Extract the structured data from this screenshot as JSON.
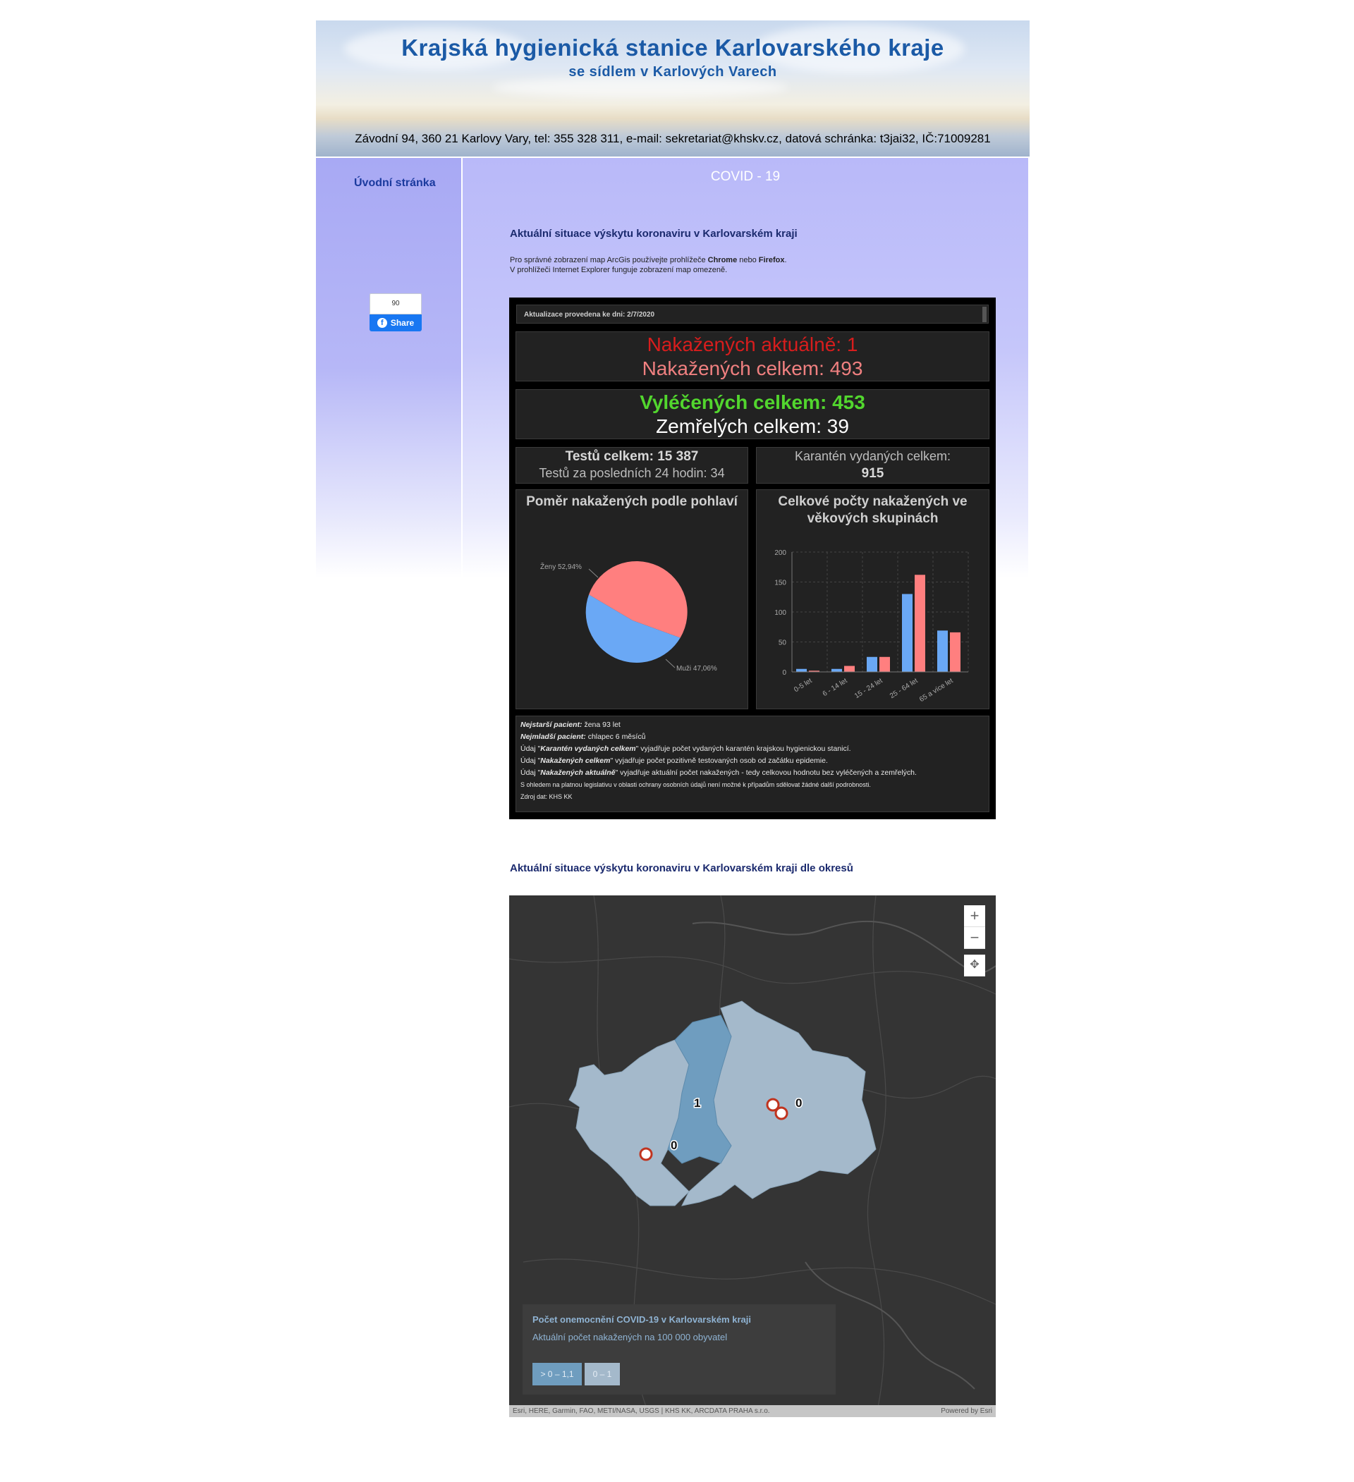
{
  "header": {
    "title": "Krajská hygienická stanice Karlovarského kraje",
    "subtitle": "se sídlem v Karlových Varech",
    "contact": "Závodní 94, 360 21 Karlovy Vary, tel: 355 328 311, e-mail: sekretariat@khskv.cz, datová schránka: t3jai32, IČ:71009281"
  },
  "sidebar": {
    "home_link": "Úvodní stránka",
    "fb_count": "90",
    "fb_share": "Share"
  },
  "main": {
    "heading": "COVID - 19",
    "section1_title": "Aktuální situace výskytu koronaviru v Karlovarském kraji",
    "note_line1_pre": "Pro správné zobrazení map ArcGis používejte prohlížeče ",
    "note_chrome": "Chrome",
    "note_mid": " nebo ",
    "note_firefox": "Firefox",
    "note_end": ".",
    "note_line2": "V prohlížeči Internet Explorer funguje zobrazení map omezeně.",
    "section2_title": "Aktuální situace výskytu koronaviru v Karlovarském kraji dle okresů"
  },
  "dashboard": {
    "update_text": "Aktualizace provedena ke dni: 2/7/2020",
    "active": "Nakažených aktuálně: 1",
    "total_infected": "Nakažených celkem: 493",
    "recovered": "Vyléčených celkem: 453",
    "deaths": "Zemřelých celkem: 39",
    "tests_total": "Testů celkem: 15 387",
    "tests_24h": "Testů za posledních 24 hodin: 34",
    "quarantine_label": "Karantén vydaných celkem:",
    "quarantine_value": "915",
    "pie_title": "Poměr nakažených podle pohlaví",
    "bar_title_1": "Celkové počty nakažených ve",
    "bar_title_2": "věkových skupinách",
    "notes": {
      "oldest_label": "Nejstarší pacient:",
      "oldest_value": " žena 93 let",
      "youngest_label": "Nejmladší pacient:",
      "youngest_value": " chlapec 6 měsíců",
      "q_pre": "Údaj \"",
      "q_term": "Karantén vydaných celkem",
      "q_post": "\" vyjadřuje počet vydaných karantén krajskou hygienickou stanicí.",
      "n_pre": "Údaj \"",
      "n_term": "Nakažených celkem",
      "n_post": "\" vyjadřuje počet pozitivně testovaných osob od začátku epidemie.",
      "a_pre": "Údaj \"",
      "a_term": "Nakažených aktuálně",
      "a_post": "\" vyjadřuje aktuální počet nakažených - tedy celkovou hodnotu bez vyléčených a zemřelých.",
      "legal": "S ohledem na platnou legislativu v oblasti ochrany osobních údajů není možné k případům sdělovat žádné další podrobnosti.",
      "source": "Zdroj dat: KHS KK"
    }
  },
  "colors": {
    "active_red": "#d71d1d",
    "total_pink": "#f08080",
    "recovered_green": "#52d62e",
    "female": "#ff7f7f",
    "male": "#6aa8f5"
  },
  "chart_data": [
    {
      "type": "pie",
      "labels": [
        "Ženy 52,94%",
        "Muži 47,06%"
      ],
      "values": [
        52.94,
        47.06
      ],
      "colors": [
        "#ff7f7f",
        "#6aa8f5"
      ]
    },
    {
      "type": "bar",
      "categories": [
        "0-5 let",
        "6 - 14 let",
        "15 - 24 let",
        "25 - 64 let",
        "65 a více let"
      ],
      "series": [
        {
          "values": [
            5,
            5,
            25,
            130,
            69
          ],
          "color": "#6aa8f5"
        },
        {
          "values": [
            2,
            10,
            25,
            162,
            66
          ],
          "color": "#ff7f7f"
        }
      ],
      "ylim": [
        0,
        200
      ],
      "yticks": [
        "0",
        "50",
        "100",
        "150",
        "200"
      ],
      "grid": true
    }
  ],
  "map": {
    "zoom_in": "+",
    "zoom_out": "−",
    "locate_icon": "locate-icon",
    "district_values": [
      "1",
      "0",
      "0"
    ],
    "legend_title": "Počet onemocnění COVID-19 v Karlovarském kraji",
    "legend_sub": "Aktuální počet nakažených na 100 000 obyvatel",
    "legend_chip_high": "> 0 – 1,1",
    "legend_chip_low": "0 – 1",
    "attribution": "Esri, HERE, Garmin, FAO, METI/NASA, USGS | KHS KK, ARCDATA PRAHA s.r.o.",
    "powered": "Powered by Esri"
  }
}
